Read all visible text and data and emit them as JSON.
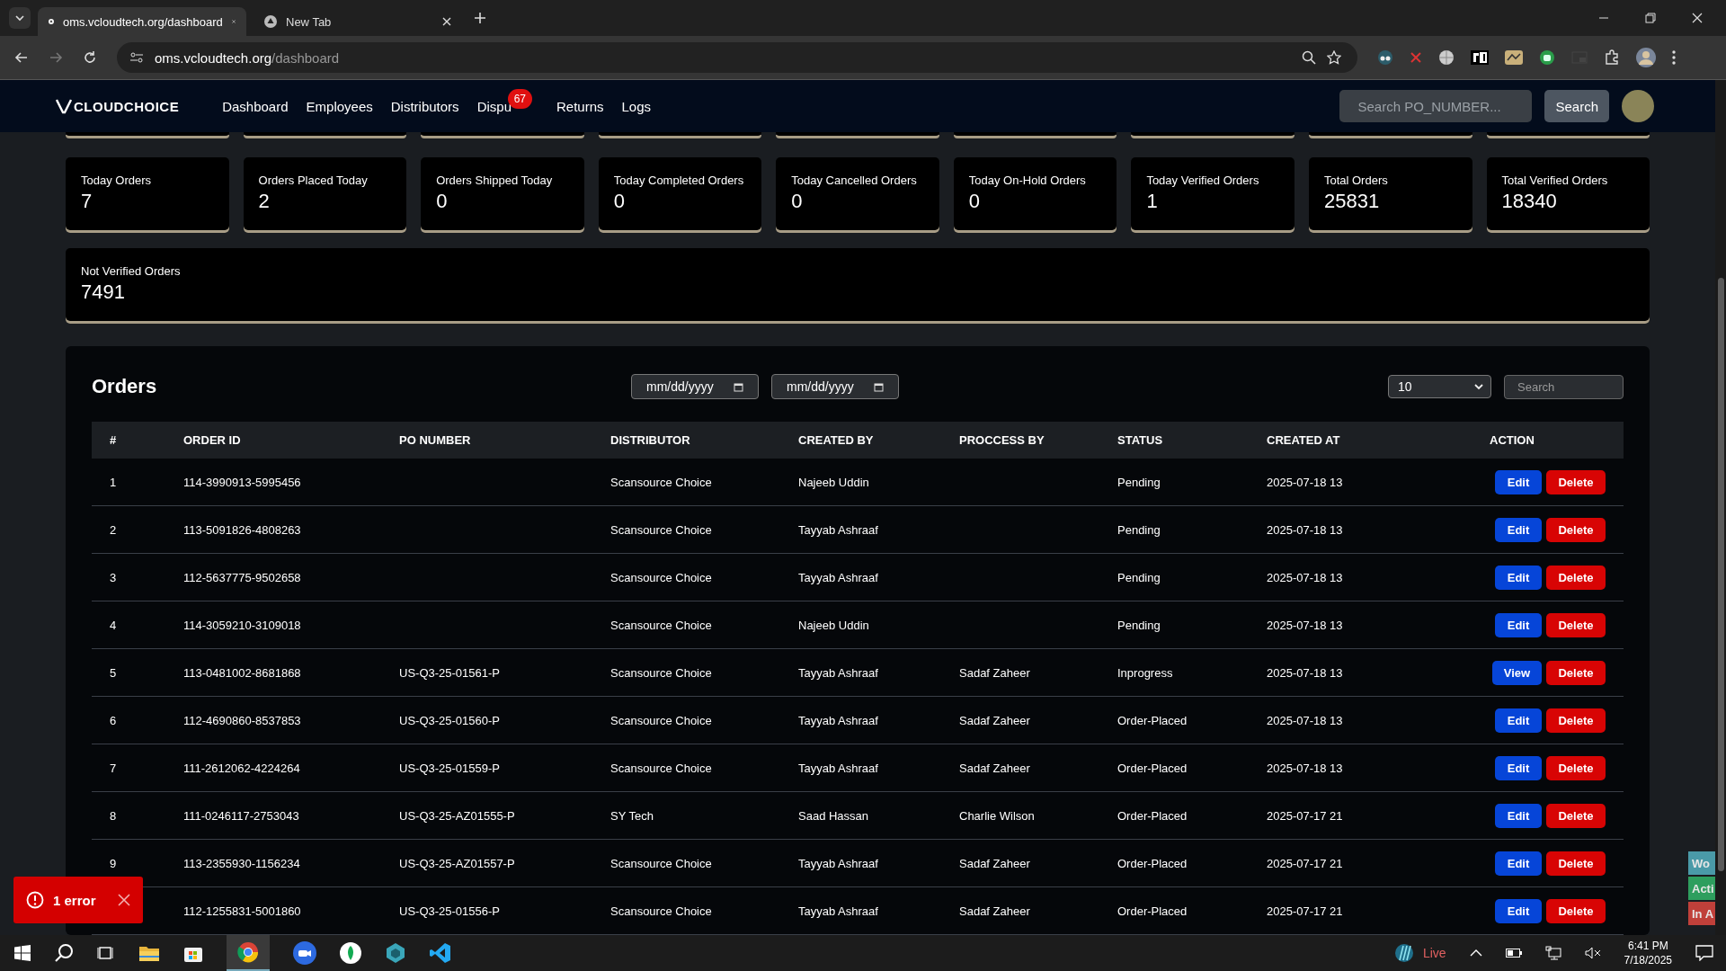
{
  "browser": {
    "tabs": [
      {
        "title": "oms.vcloudtech.org/dashboard",
        "selected": true
      },
      {
        "title": "New Tab",
        "selected": false
      }
    ],
    "url_host": "oms.vcloudtech.org",
    "url_path": "/dashboard"
  },
  "nav": {
    "logo": "CLOUDCHOICE",
    "items": [
      {
        "label": "Dashboard"
      },
      {
        "label": "Employees"
      },
      {
        "label": "Distributors"
      },
      {
        "label": "Dispu",
        "badge": "67"
      },
      {
        "label": "Returns"
      },
      {
        "label": "Logs"
      }
    ],
    "search_placeholder": "Search PO_NUMBER...",
    "search_button": "Search"
  },
  "stats": [
    {
      "label": "Today Orders",
      "value": "7"
    },
    {
      "label": "Orders Placed Today",
      "value": "2"
    },
    {
      "label": "Orders Shipped Today",
      "value": "0"
    },
    {
      "label": "Today Completed Orders",
      "value": "0"
    },
    {
      "label": "Today Cancelled Orders",
      "value": "0"
    },
    {
      "label": "Today On-Hold Orders",
      "value": "0"
    },
    {
      "label": "Today Verified Orders",
      "value": "1"
    },
    {
      "label": "Total Orders",
      "value": "25831"
    },
    {
      "label": "Total Verified Orders",
      "value": "18340"
    }
  ],
  "wide_stat": {
    "label": "Not Verified Orders",
    "value": "7491"
  },
  "orders": {
    "title": "Orders",
    "date_from": "mm/dd/yyyy",
    "date_to": "mm/dd/yyyy",
    "page_size": "10",
    "search_placeholder": "Search",
    "columns": [
      "#",
      "ORDER ID",
      "PO NUMBER",
      "DISTRIBUTOR",
      "CREATED BY",
      "PROCCESS BY",
      "STATUS",
      "CREATED AT",
      "ACTION"
    ],
    "rows": [
      {
        "n": "1",
        "order_id": "114-3990913-5995456",
        "distributor": "Scansource Choice",
        "created_by": "Najeeb Uddin",
        "status": "Pending",
        "created_at": "2025-07-18 13",
        "actions": [
          {
            "kind": "edit",
            "label": "Edit"
          },
          {
            "kind": "delete",
            "label": "Delete"
          }
        ]
      },
      {
        "n": "2",
        "order_id": "113-5091826-4808263",
        "distributor": "Scansource Choice",
        "created_by": "Tayyab Ashraaf",
        "status": "Pending",
        "created_at": "2025-07-18 13",
        "actions": [
          {
            "kind": "edit",
            "label": "Edit"
          },
          {
            "kind": "delete",
            "label": "Delete"
          }
        ]
      },
      {
        "n": "3",
        "order_id": "112-5637775-9502658",
        "distributor": "Scansource Choice",
        "created_by": "Tayyab Ashraaf",
        "status": "Pending",
        "created_at": "2025-07-18 13",
        "actions": [
          {
            "kind": "edit",
            "label": "Edit"
          },
          {
            "kind": "delete",
            "label": "Delete"
          }
        ]
      },
      {
        "n": "4",
        "order_id": "114-3059210-3109018",
        "distributor": "Scansource Choice",
        "created_by": "Najeeb Uddin",
        "status": "Pending",
        "created_at": "2025-07-18 13",
        "actions": [
          {
            "kind": "edit",
            "label": "Edit"
          },
          {
            "kind": "delete",
            "label": "Delete"
          }
        ]
      },
      {
        "n": "5",
        "order_id": "113-0481002-8681868",
        "po": "US-Q3-25-01561-P",
        "distributor": "Scansource Choice",
        "created_by": "Tayyab Ashraaf",
        "process_by": "Sadaf Zaheer",
        "status": "Inprogress",
        "created_at": "2025-07-18 13",
        "actions": [
          {
            "kind": "view",
            "label": "View"
          },
          {
            "kind": "delete",
            "label": "Delete"
          }
        ]
      },
      {
        "n": "6",
        "order_id": "112-4690860-8537853",
        "po": "US-Q3-25-01560-P",
        "distributor": "Scansource Choice",
        "created_by": "Tayyab Ashraaf",
        "process_by": "Sadaf Zaheer",
        "status": "Order-Placed",
        "created_at": "2025-07-18 13",
        "actions": [
          {
            "kind": "edit",
            "label": "Edit"
          },
          {
            "kind": "delete",
            "label": "Delete"
          }
        ]
      },
      {
        "n": "7",
        "order_id": "111-2612062-4224264",
        "po": "US-Q3-25-01559-P",
        "distributor": "Scansource Choice",
        "created_by": "Tayyab Ashraaf",
        "process_by": "Sadaf Zaheer",
        "status": "Order-Placed",
        "created_at": "2025-07-18 13",
        "actions": [
          {
            "kind": "edit",
            "label": "Edit"
          },
          {
            "kind": "delete",
            "label": "Delete"
          }
        ]
      },
      {
        "n": "8",
        "order_id": "111-0246117-2753043",
        "po": "US-Q3-25-AZ01555-P",
        "distributor": "SY Tech",
        "created_by": "Saad Hassan",
        "process_by": "Charlie Wilson",
        "status": "Order-Placed",
        "created_at": "2025-07-17 21",
        "actions": [
          {
            "kind": "edit",
            "label": "Edit"
          },
          {
            "kind": "delete",
            "label": "Delete"
          }
        ]
      },
      {
        "n": "9",
        "order_id": "113-2355930-1156234",
        "po": "US-Q3-25-AZ01557-P",
        "distributor": "Scansource Choice",
        "created_by": "Tayyab Ashraaf",
        "process_by": "Sadaf Zaheer",
        "status": "Order-Placed",
        "created_at": "2025-07-17 21",
        "actions": [
          {
            "kind": "edit",
            "label": "Edit"
          },
          {
            "kind": "delete",
            "label": "Delete"
          }
        ]
      },
      {
        "order_id": "112-1255831-5001860",
        "po": "US-Q3-25-01556-P",
        "distributor": "Scansource Choice",
        "created_by": "Tayyab Ashraaf",
        "process_by": "Sadaf Zaheer",
        "status": "Order-Placed",
        "created_at": "2025-07-17 21",
        "actions": [
          {
            "kind": "edit",
            "label": "Edit"
          },
          {
            "kind": "delete",
            "label": "Delete"
          }
        ]
      }
    ]
  },
  "error_toast": {
    "label": "1 error"
  },
  "side_tabs": [
    {
      "label": "Wo",
      "color": "#4a9aa8"
    },
    {
      "label": "Acti",
      "color": "#2e9e5e"
    },
    {
      "label": "In A",
      "color": "#c0403a"
    }
  ],
  "taskbar": {
    "live": "Live",
    "time": "6:41 PM",
    "date": "7/18/2025"
  }
}
